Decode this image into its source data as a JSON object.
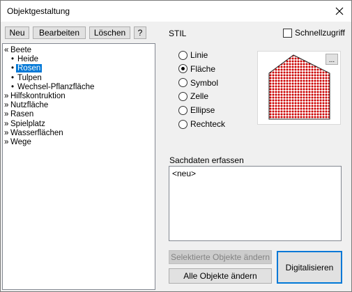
{
  "window": {
    "title": "Objektgestaltung"
  },
  "toolbar": {
    "new_label": "Neu",
    "edit_label": "Bearbeiten",
    "delete_label": "Löschen",
    "help_label": "?"
  },
  "tree": {
    "nodes": [
      {
        "prefix": "«",
        "label": "Beete"
      },
      {
        "prefix": "•",
        "label": "Heide"
      },
      {
        "prefix": "•",
        "label": "Rosen",
        "selected": true
      },
      {
        "prefix": "•",
        "label": "Tulpen"
      },
      {
        "prefix": "•",
        "label": "Wechsel-Pflanzfläche"
      },
      {
        "prefix": "»",
        "label": "Hilfskontruktion"
      },
      {
        "prefix": "»",
        "label": "Nutzfläche"
      },
      {
        "prefix": "»",
        "label": "Rasen"
      },
      {
        "prefix": "»",
        "label": "Spielplatz"
      },
      {
        "prefix": "»",
        "label": "Wasserflächen"
      },
      {
        "prefix": "»",
        "label": "Wege"
      }
    ]
  },
  "stil": {
    "label": "STIL",
    "quick_access_label": "Schnellzugriff",
    "quick_access_checked": false,
    "options": [
      "Linie",
      "Fläche",
      "Symbol",
      "Zelle",
      "Ellipse",
      "Rechteck"
    ],
    "selected": "Fläche",
    "more_label": "...",
    "preview_colors": {
      "fill": "#ffffff",
      "dots": "#cc0000",
      "stroke": "#222222"
    }
  },
  "sachdaten": {
    "label": "Sachdaten erfassen",
    "value": "<neu>"
  },
  "actions": {
    "change_selected_label": "Selektierte Objekte ändern",
    "change_all_label": "Alle Objekte ändern",
    "digitize_label": "Digitalisieren"
  }
}
